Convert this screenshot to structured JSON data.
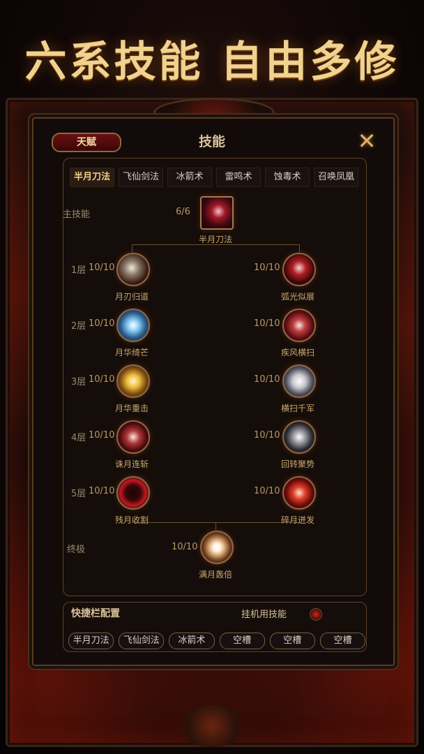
{
  "headline": "六系技能 自由多修",
  "header": {
    "talent_tab": "天赋",
    "title": "技能",
    "close_glyph": "✕"
  },
  "school_tabs": [
    "半月刀法",
    "飞仙剑法",
    "冰箭术",
    "雷鸣术",
    "蚀毒术",
    "召唤凤凰"
  ],
  "active_school": "半月刀法",
  "main_skill": {
    "row_label": "主技能",
    "level": "6/6",
    "name": "半月刀法"
  },
  "tiers": [
    {
      "label": "1层",
      "left": {
        "level": "10/10",
        "name": "月刃归道"
      },
      "right": {
        "level": "10/10",
        "name": "弧光似展"
      }
    },
    {
      "label": "2层",
      "left": {
        "level": "10/10",
        "name": "月华绮芒"
      },
      "right": {
        "level": "10/10",
        "name": "疾风横扫"
      }
    },
    {
      "label": "3层",
      "left": {
        "level": "10/10",
        "name": "月华重击"
      },
      "right": {
        "level": "10/10",
        "name": "横扫千军"
      }
    },
    {
      "label": "4层",
      "left": {
        "level": "10/10",
        "name": "诛月连斩"
      },
      "right": {
        "level": "10/10",
        "name": "回转聚势"
      }
    },
    {
      "label": "5层",
      "left": {
        "level": "10/10",
        "name": "残月收割"
      },
      "right": {
        "level": "10/10",
        "name": "碎月迸发"
      }
    }
  ],
  "ultimate": {
    "row_label": "终极",
    "level": "10/10",
    "name": "满月轰倍"
  },
  "quickbar": {
    "title": "快捷栏配置",
    "auto_label": "挂机用技能",
    "slots": [
      "半月刀法",
      "飞仙剑法",
      "冰箭术",
      "空槽",
      "空槽",
      "空槽"
    ]
  }
}
